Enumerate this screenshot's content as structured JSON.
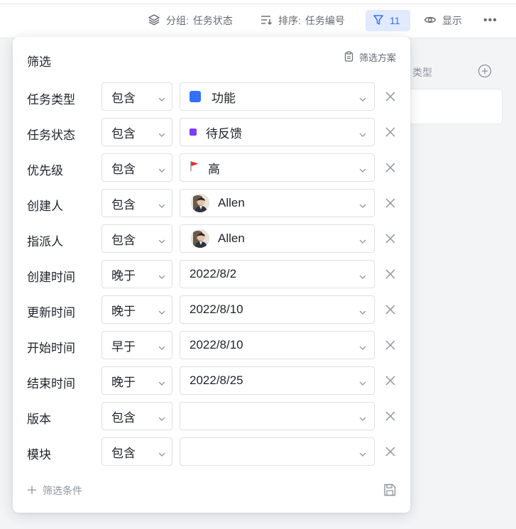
{
  "toolbar": {
    "group_label": "分组:",
    "group_value": "任务状态",
    "sort_label": "排序:",
    "sort_value": "任务编号",
    "filter_count": "11",
    "show_label": "显示",
    "more": "•••"
  },
  "background": {
    "type_label": "类型"
  },
  "panel": {
    "title": "筛选",
    "scheme_label": "筛选方案",
    "add_condition_label": "筛选条件",
    "rows": [
      {
        "label": "任务类型",
        "op": "包含",
        "value": "功能",
        "value_icon": "blue-square"
      },
      {
        "label": "任务状态",
        "op": "包含",
        "value": "待反馈",
        "value_icon": "purple-dot"
      },
      {
        "label": "优先级",
        "op": "包含",
        "value": "高",
        "value_icon": "red-flag"
      },
      {
        "label": "创建人",
        "op": "包含",
        "value": "Allen",
        "value_icon": "avatar"
      },
      {
        "label": "指派人",
        "op": "包含",
        "value": "Allen",
        "value_icon": "avatar"
      },
      {
        "label": "创建时间",
        "op": "晚于",
        "value": "2022/8/2",
        "value_icon": ""
      },
      {
        "label": "更新时间",
        "op": "晚于",
        "value": "2022/8/10",
        "value_icon": ""
      },
      {
        "label": "开始时间",
        "op": "早于",
        "value": "2022/8/10",
        "value_icon": ""
      },
      {
        "label": "结束时间",
        "op": "晚于",
        "value": "2022/8/25",
        "value_icon": ""
      },
      {
        "label": "版本",
        "op": "包含",
        "value": "",
        "value_icon": ""
      },
      {
        "label": "模块",
        "op": "包含",
        "value": "",
        "value_icon": ""
      }
    ]
  },
  "colors": {
    "accent": "#3370ff",
    "accent_bg": "#e1eaff",
    "status_purple": "#7f3bf5",
    "flag_red": "#e22e28"
  }
}
